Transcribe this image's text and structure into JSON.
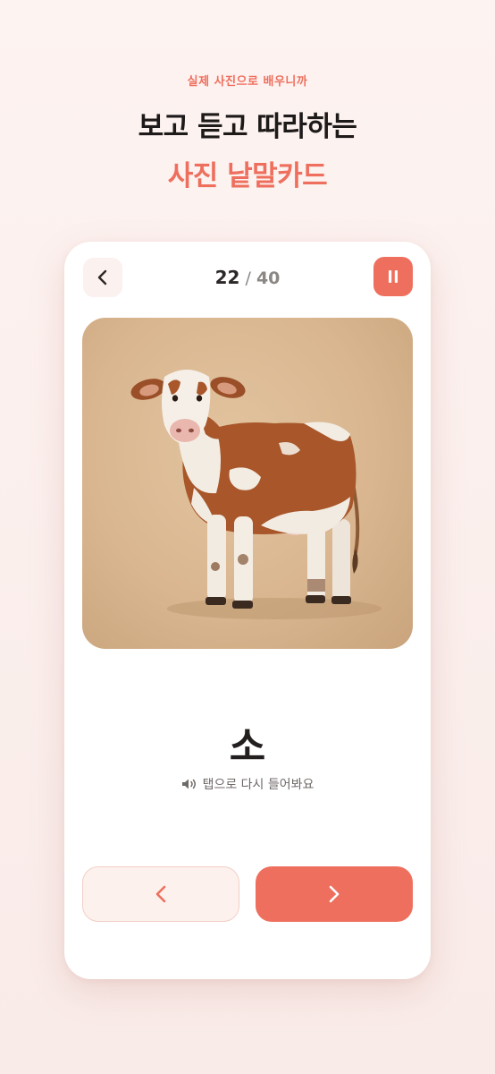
{
  "header": {
    "eyebrow": "실제 사진으로 배우니까",
    "headline": "보고 듣고 따라하는",
    "headline_accent": "사진 낱말카드"
  },
  "card": {
    "progress": {
      "current": "22",
      "separator": "/",
      "total": "40"
    },
    "photo_subject": "cow",
    "word": "소",
    "hint": "탭으로 다시 들어봐요"
  },
  "icons": {
    "back": "chevron-left-icon",
    "pause": "pause-icon",
    "speaker": "speaker-icon",
    "prev": "chevron-left-icon",
    "next": "chevron-right-icon"
  },
  "colors": {
    "accent": "#ee6f5d",
    "background": "#fdf3f1",
    "text": "#1d1a19"
  }
}
